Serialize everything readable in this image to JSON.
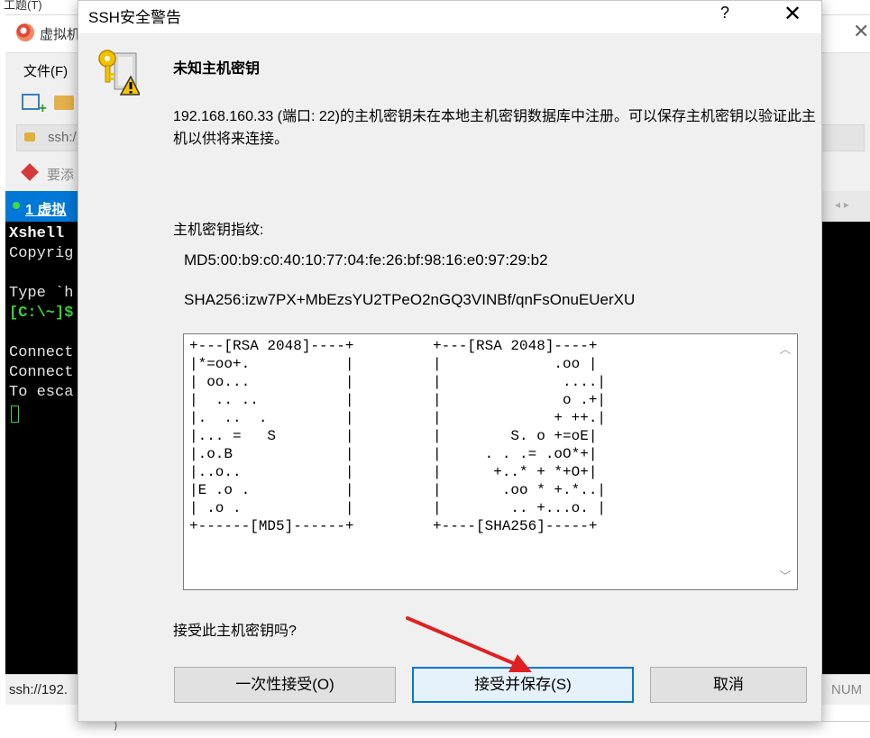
{
  "background": {
    "top_strip_text": "工题(T)",
    "window_title": "虚拟机",
    "menu_file": "文件(F)",
    "address_text": "ssh:/",
    "link_text": "要添",
    "tab_label": "1 虚拟",
    "tab_arrows": "◂ ▸",
    "terminal_lines": [
      "Xshell",
      "Copyrig",
      "",
      "Type `h",
      "[C:\\~]$",
      "",
      "Connect",
      "Connect",
      "To esca"
    ],
    "status_text": "ssh://192.",
    "status_num": "NUM"
  },
  "dialog": {
    "title": "SSH安全警告",
    "help_label": "?",
    "close_label": "✕",
    "heading": "未知主机密钥",
    "message": "192.168.160.33 (端口: 22)的主机密钥未在本地主机密钥数据库中注册。可以保存主机密钥以验证此主机以供将来连接。",
    "fingerprint_label": "主机密钥指纹:",
    "md5": "MD5:00:b9:c0:40:10:77:04:fe:26:bf:98:16:e0:97:29:b2",
    "sha256": "SHA256:izw7PX+MbEzsYU2TPeO2nGQ3VINBf/qnFsOnuEUerXU",
    "randomart_md5": "+---[RSA 2048]----+\n|*=oo+.           |\n| oo...           |\n|  .. ..          |\n|.  ..  .         |\n|... =   S        |\n|.o.B             |\n|..o..            |\n|E .o .           |\n| .o .            |\n+------[MD5]------+",
    "randomart_sha256": "+---[RSA 2048]----+\n|             .oo |\n|              ....|\n|              o .+|\n|             + ++.|\n|        S. o +=oE|\n|     . . .= .oO*+|\n|      +..* + *+O+|\n|       .oo * +.*..|\n|        .. +...o. |\n+----[SHA256]-----+",
    "question": "接受此主机密钥吗?",
    "buttons": {
      "accept_once": "一次性接受(O)",
      "accept_save": "接受并保存(S)",
      "cancel": "取消"
    },
    "scroll_up": "︿",
    "scroll_down": "﹀"
  },
  "colors": {
    "accent": "#0078d7",
    "annotation_arrow": "#e02020",
    "dialog_bg": "#f0f0f0",
    "terminal_bg": "#000000",
    "terminal_prompt": "#3cd23c"
  }
}
